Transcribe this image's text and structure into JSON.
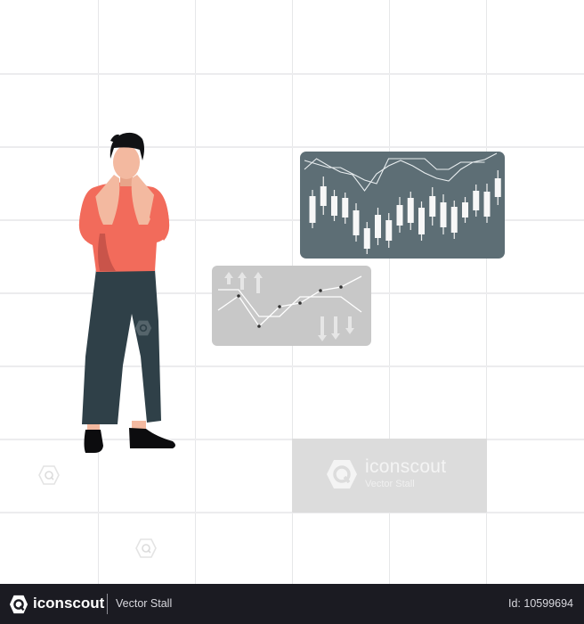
{
  "scene": {
    "description": "Man covering face with hands next to stock market charts",
    "colors": {
      "background": "#ffffff",
      "grid": "#e6e7e9",
      "shirt": "#f26b5b",
      "shirt_shadow": "#c9544a",
      "skin": "#f3b9a0",
      "skin_shadow": "#e8a489",
      "hair": "#111214",
      "pants": "#2f4048",
      "shoes": "#0c0c0e",
      "candle_panel": "#5d6e75",
      "line_panel": "#c8c8c8",
      "chart_lines": "#ffffff",
      "footer_bg": "#1b1b22"
    }
  },
  "candle_panel": {
    "chart_data": {
      "type": "candlestick",
      "note": "values in arbitrary price units (higher = up)",
      "candles": [
        {
          "low": 34,
          "high": 77,
          "open": 40,
          "close": 70
        },
        {
          "low": 49,
          "high": 92,
          "open": 59,
          "close": 81
        },
        {
          "low": 42,
          "high": 77,
          "open": 48,
          "close": 70
        },
        {
          "low": 39,
          "high": 74,
          "open": 46,
          "close": 68
        },
        {
          "low": 19,
          "high": 62,
          "open": 26,
          "close": 54
        },
        {
          "low": 5,
          "high": 41,
          "open": 11,
          "close": 34
        },
        {
          "low": 15,
          "high": 57,
          "open": 23,
          "close": 49
        },
        {
          "low": 12,
          "high": 51,
          "open": 20,
          "close": 43
        },
        {
          "low": 29,
          "high": 69,
          "open": 37,
          "close": 60
        },
        {
          "low": 32,
          "high": 75,
          "open": 40,
          "close": 68
        },
        {
          "low": 20,
          "high": 64,
          "open": 27,
          "close": 57
        },
        {
          "low": 37,
          "high": 80,
          "open": 47,
          "close": 70
        },
        {
          "low": 27,
          "high": 72,
          "open": 35,
          "close": 63
        },
        {
          "low": 22,
          "high": 65,
          "open": 29,
          "close": 58
        },
        {
          "low": 40,
          "high": 69,
          "open": 46,
          "close": 63
        },
        {
          "low": 47,
          "high": 83,
          "open": 54,
          "close": 76
        },
        {
          "low": 40,
          "high": 84,
          "open": 47,
          "close": 75
        },
        {
          "low": 60,
          "high": 99,
          "open": 69,
          "close": 90
        }
      ],
      "line_a": [
        [
          0,
          100
        ],
        [
          1,
          112
        ],
        [
          2,
          104
        ],
        [
          3,
          97
        ],
        [
          4,
          94
        ],
        [
          5,
          76
        ],
        [
          6,
          95
        ],
        [
          7,
          104
        ],
        [
          8,
          110
        ],
        [
          9,
          104
        ],
        [
          10,
          96
        ],
        [
          11,
          90
        ],
        [
          12,
          87
        ],
        [
          13,
          100
        ],
        [
          14,
          108
        ],
        [
          15,
          111
        ],
        [
          16,
          118
        ]
      ],
      "line_b": [
        [
          0,
          110
        ],
        [
          1,
          106
        ],
        [
          2,
          102
        ],
        [
          3,
          102
        ],
        [
          4,
          95
        ],
        [
          5,
          88
        ],
        [
          6,
          84
        ],
        [
          7,
          112
        ],
        [
          8,
          112
        ],
        [
          9,
          112
        ],
        [
          10,
          112
        ],
        [
          11,
          100
        ],
        [
          12,
          100
        ],
        [
          13,
          108
        ],
        [
          14,
          108
        ],
        [
          15,
          108
        ]
      ]
    }
  },
  "line_panel": {
    "up_arrows": 3,
    "down_arrows": 3,
    "chart_data": {
      "type": "line",
      "series": [
        {
          "name": "markers",
          "values": [
            40,
            56,
            22,
            44,
            48,
            62,
            66,
            78
          ],
          "markers": true
        },
        {
          "name": "plain",
          "values": [
            63,
            63,
            33,
            33,
            55,
            55,
            55,
            38
          ]
        }
      ]
    }
  },
  "watermark": {
    "title": "iconscout",
    "subtitle": "Vector Stall"
  },
  "footer": {
    "brand": "iconscout",
    "author": "Vector Stall",
    "id_label": "Id: 10599694"
  }
}
